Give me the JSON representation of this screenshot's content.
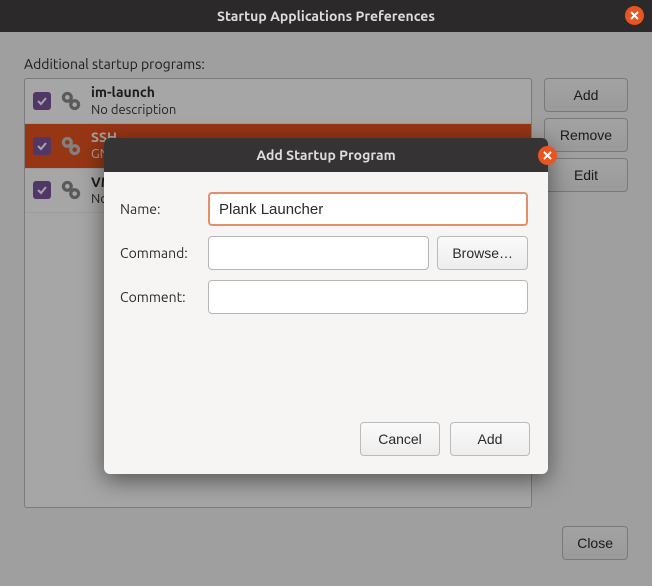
{
  "window": {
    "title": "Startup Applications Preferences",
    "section_label": "Additional startup programs:",
    "buttons": {
      "add": "Add",
      "remove": "Remove",
      "edit": "Edit",
      "close": "Close"
    }
  },
  "list": [
    {
      "name": "im-launch",
      "desc": "No description",
      "checked": true,
      "selected": false
    },
    {
      "name": "SSH",
      "desc": "GN",
      "checked": true,
      "selected": true
    },
    {
      "name": "VM",
      "desc": "No",
      "checked": true,
      "selected": false
    }
  ],
  "dialog": {
    "title": "Add Startup Program",
    "labels": {
      "name": "Name:",
      "command": "Command:",
      "comment": "Comment:"
    },
    "values": {
      "name": "Plank Launcher",
      "command": "",
      "comment": ""
    },
    "buttons": {
      "browse": "Browse…",
      "cancel": "Cancel",
      "add": "Add"
    }
  }
}
